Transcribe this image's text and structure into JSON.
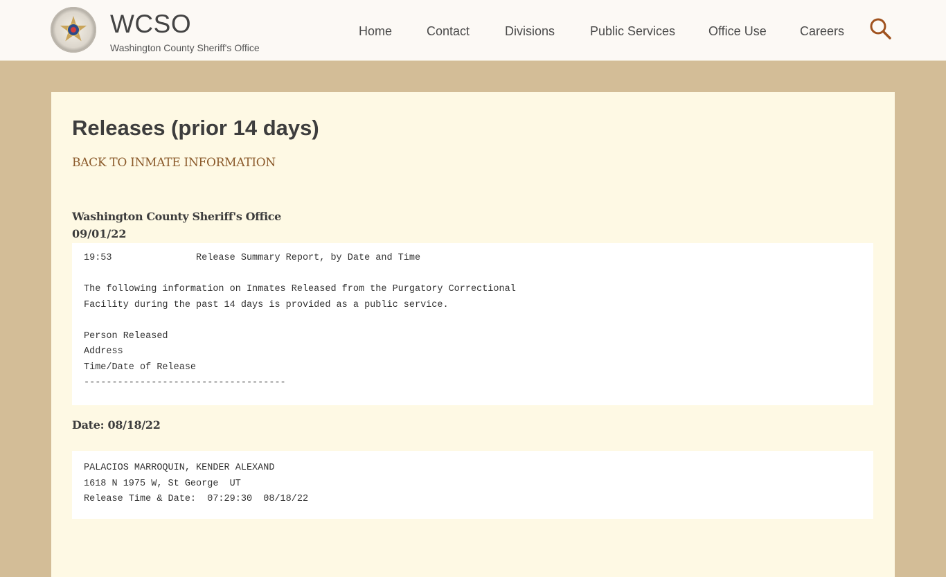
{
  "header": {
    "brand_title": "WCSO",
    "brand_subtitle": "Washington County Sheriff's Office",
    "logo_alt": "Washington County Deputy Sheriff badge",
    "nav": [
      {
        "label": "Home"
      },
      {
        "label": "Contact"
      },
      {
        "label": "Divisions"
      },
      {
        "label": "Public Services"
      },
      {
        "label": "Office Use"
      },
      {
        "label": "Careers"
      }
    ],
    "search_icon": "search-icon"
  },
  "colors": {
    "page_background": "#d3bd97",
    "header_background": "#fcf9f5",
    "panel_background": "#fef9e4",
    "accent": "#8b5a2b",
    "search_icon": "#a0521e"
  },
  "main": {
    "title": "Releases (prior 14 days)",
    "back_link": "BACK TO INMATE INFORMATION",
    "org_name": "Washington County Sheriff's Office",
    "report_date": "09/01/22",
    "report_header": {
      "lines": [
        "19:53               Release Summary Report, by Date and Time",
        "",
        "The following information on Inmates Released from the Purgatory Correctional",
        "Facility during the past 14 days is provided as a public service.",
        "",
        "Person Released",
        "Address",
        "Time/Date of Release",
        "------------------------------------"
      ]
    },
    "date_groups": [
      {
        "heading": "Date: 08/18/22",
        "records": [
          {
            "name": "PALACIOS MARROQUIN, KENDER ALEXAND",
            "address": "1618 N 1975 W, St George  UT",
            "release": "Release Time & Date:  07:29:30  08/18/22"
          }
        ]
      }
    ]
  }
}
